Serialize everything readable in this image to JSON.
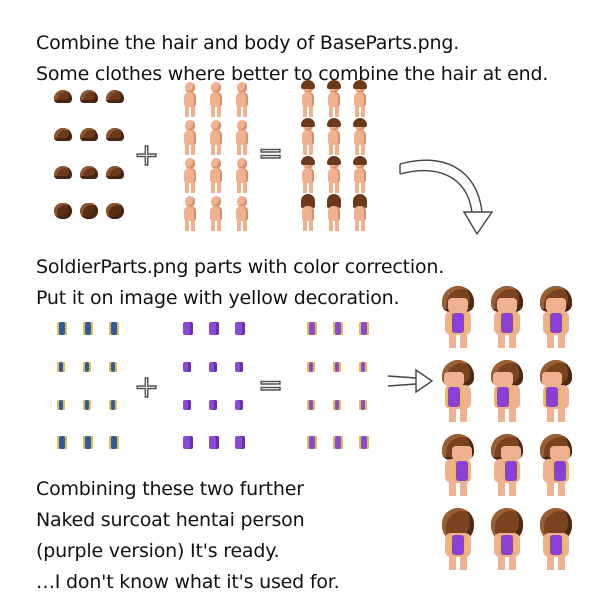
{
  "intro": {
    "line1": "Combine the hair and body of BaseParts.png.",
    "line2": "Some clothes where better to combine the hair at end."
  },
  "soldier": {
    "line1": "SoldierParts.png parts with color correction.",
    "line2": "Put it on image with yellow decoration."
  },
  "final": {
    "line1": "Combining these two further",
    "line2": "Naked surcoat hentai person",
    "line3": "(purple version) It's ready.",
    "line4": "…I don't know what it's used for."
  },
  "operators": {
    "plus": "+",
    "equals": "="
  },
  "colors": {
    "hair": "#6b3a1c",
    "skin": "#f0b190",
    "blue": "#2c5aa8",
    "purple": "#8a4ad8",
    "gold": "#e8c040"
  }
}
